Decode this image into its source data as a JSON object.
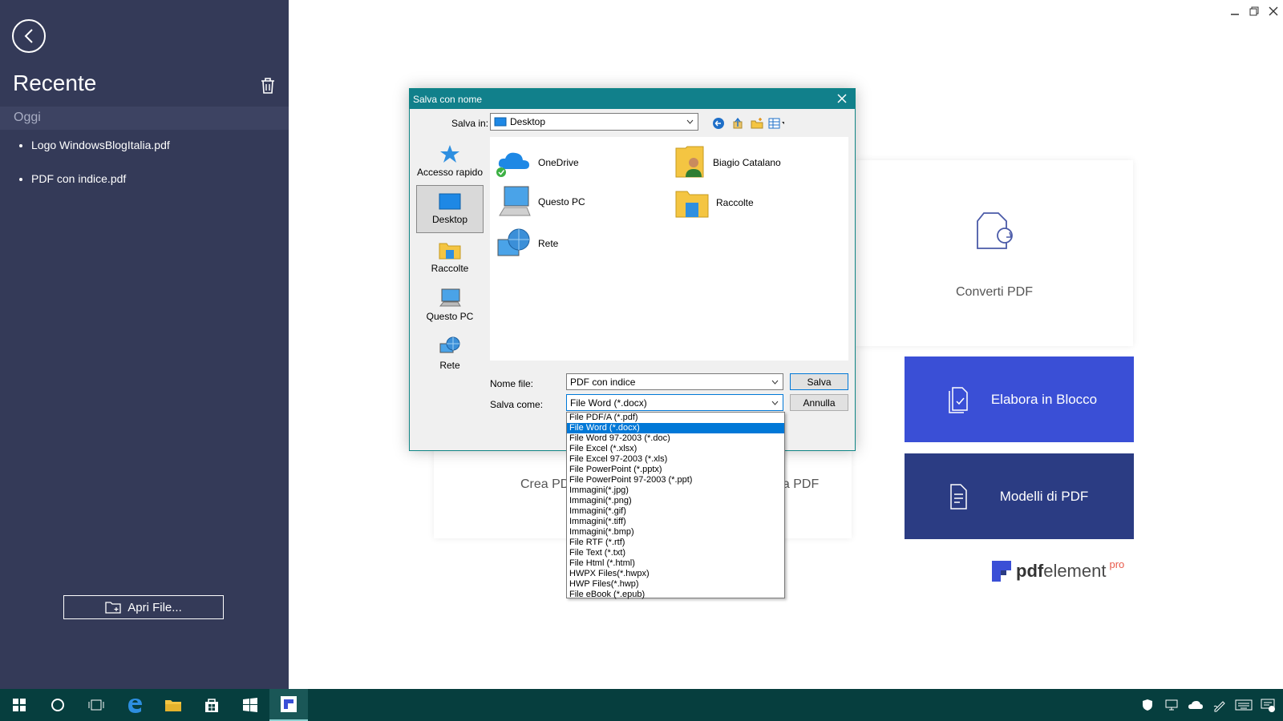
{
  "sidebar": {
    "title": "Recente",
    "section": "Oggi",
    "recent_files": [
      "Logo WindowsBlogItalia.pdf",
      "PDF con indice.pdf"
    ],
    "open_file_label": "Apri File..."
  },
  "main": {
    "convert_label": "Converti PDF",
    "create_label_partial": "Crea PDF",
    "combine_label_partial": "na PDF",
    "batch_label": "Elabora in Blocco",
    "templates_label": "Modelli di PDF",
    "brand_name_bold": "pdf",
    "brand_name_rest": "element",
    "brand_tier": "pro"
  },
  "dialog": {
    "title": "Salva con nome",
    "save_in_label": "Salva in:",
    "save_in_value": "Desktop",
    "places": [
      {
        "label": "Accesso rapido",
        "icon": "star-icon"
      },
      {
        "label": "Desktop",
        "icon": "desktop-icon"
      },
      {
        "label": "Raccolte",
        "icon": "library-icon"
      },
      {
        "label": "Questo PC",
        "icon": "computer-icon"
      },
      {
        "label": "Rete",
        "icon": "network-icon"
      }
    ],
    "items": [
      {
        "label": "OneDrive",
        "icon": "onedrive-icon"
      },
      {
        "label": "Biagio Catalano",
        "icon": "user-folder-icon"
      },
      {
        "label": "Questo PC",
        "icon": "computer-icon"
      },
      {
        "label": "Raccolte",
        "icon": "library-icon"
      },
      {
        "label": "Rete",
        "icon": "network-icon"
      }
    ],
    "filename_label": "Nome file:",
    "filename_value": "PDF con indice",
    "save_as_label": "Salva come:",
    "save_as_value": "File Word (*.docx)",
    "save_button": "Salva",
    "cancel_button": "Annulla",
    "file_types": [
      "File PDF/A (*.pdf)",
      "File Word (*.docx)",
      "File Word 97-2003 (*.doc)",
      "File Excel (*.xlsx)",
      "File Excel 97-2003 (*.xls)",
      "File PowerPoint (*.pptx)",
      "File PowerPoint 97-2003 (*.ppt)",
      "Immagini(*.jpg)",
      "Immagini(*.png)",
      "Immagini(*.gif)",
      "Immagini(*.tiff)",
      "Immagini(*.bmp)",
      "File RTF (*.rtf)",
      "File Text (*.txt)",
      "File Html (*.html)",
      "HWPX Files(*.hwpx)",
      "HWP Files(*.hwp)",
      "File eBook (*.epub)"
    ],
    "selected_file_type_index": 1
  },
  "colors": {
    "sidebar_bg": "#343a58",
    "accent_blue": "#3a4fd6",
    "accent_navy": "#2b3c83",
    "dialog_title": "#11808b",
    "taskbar": "#063e3e"
  }
}
